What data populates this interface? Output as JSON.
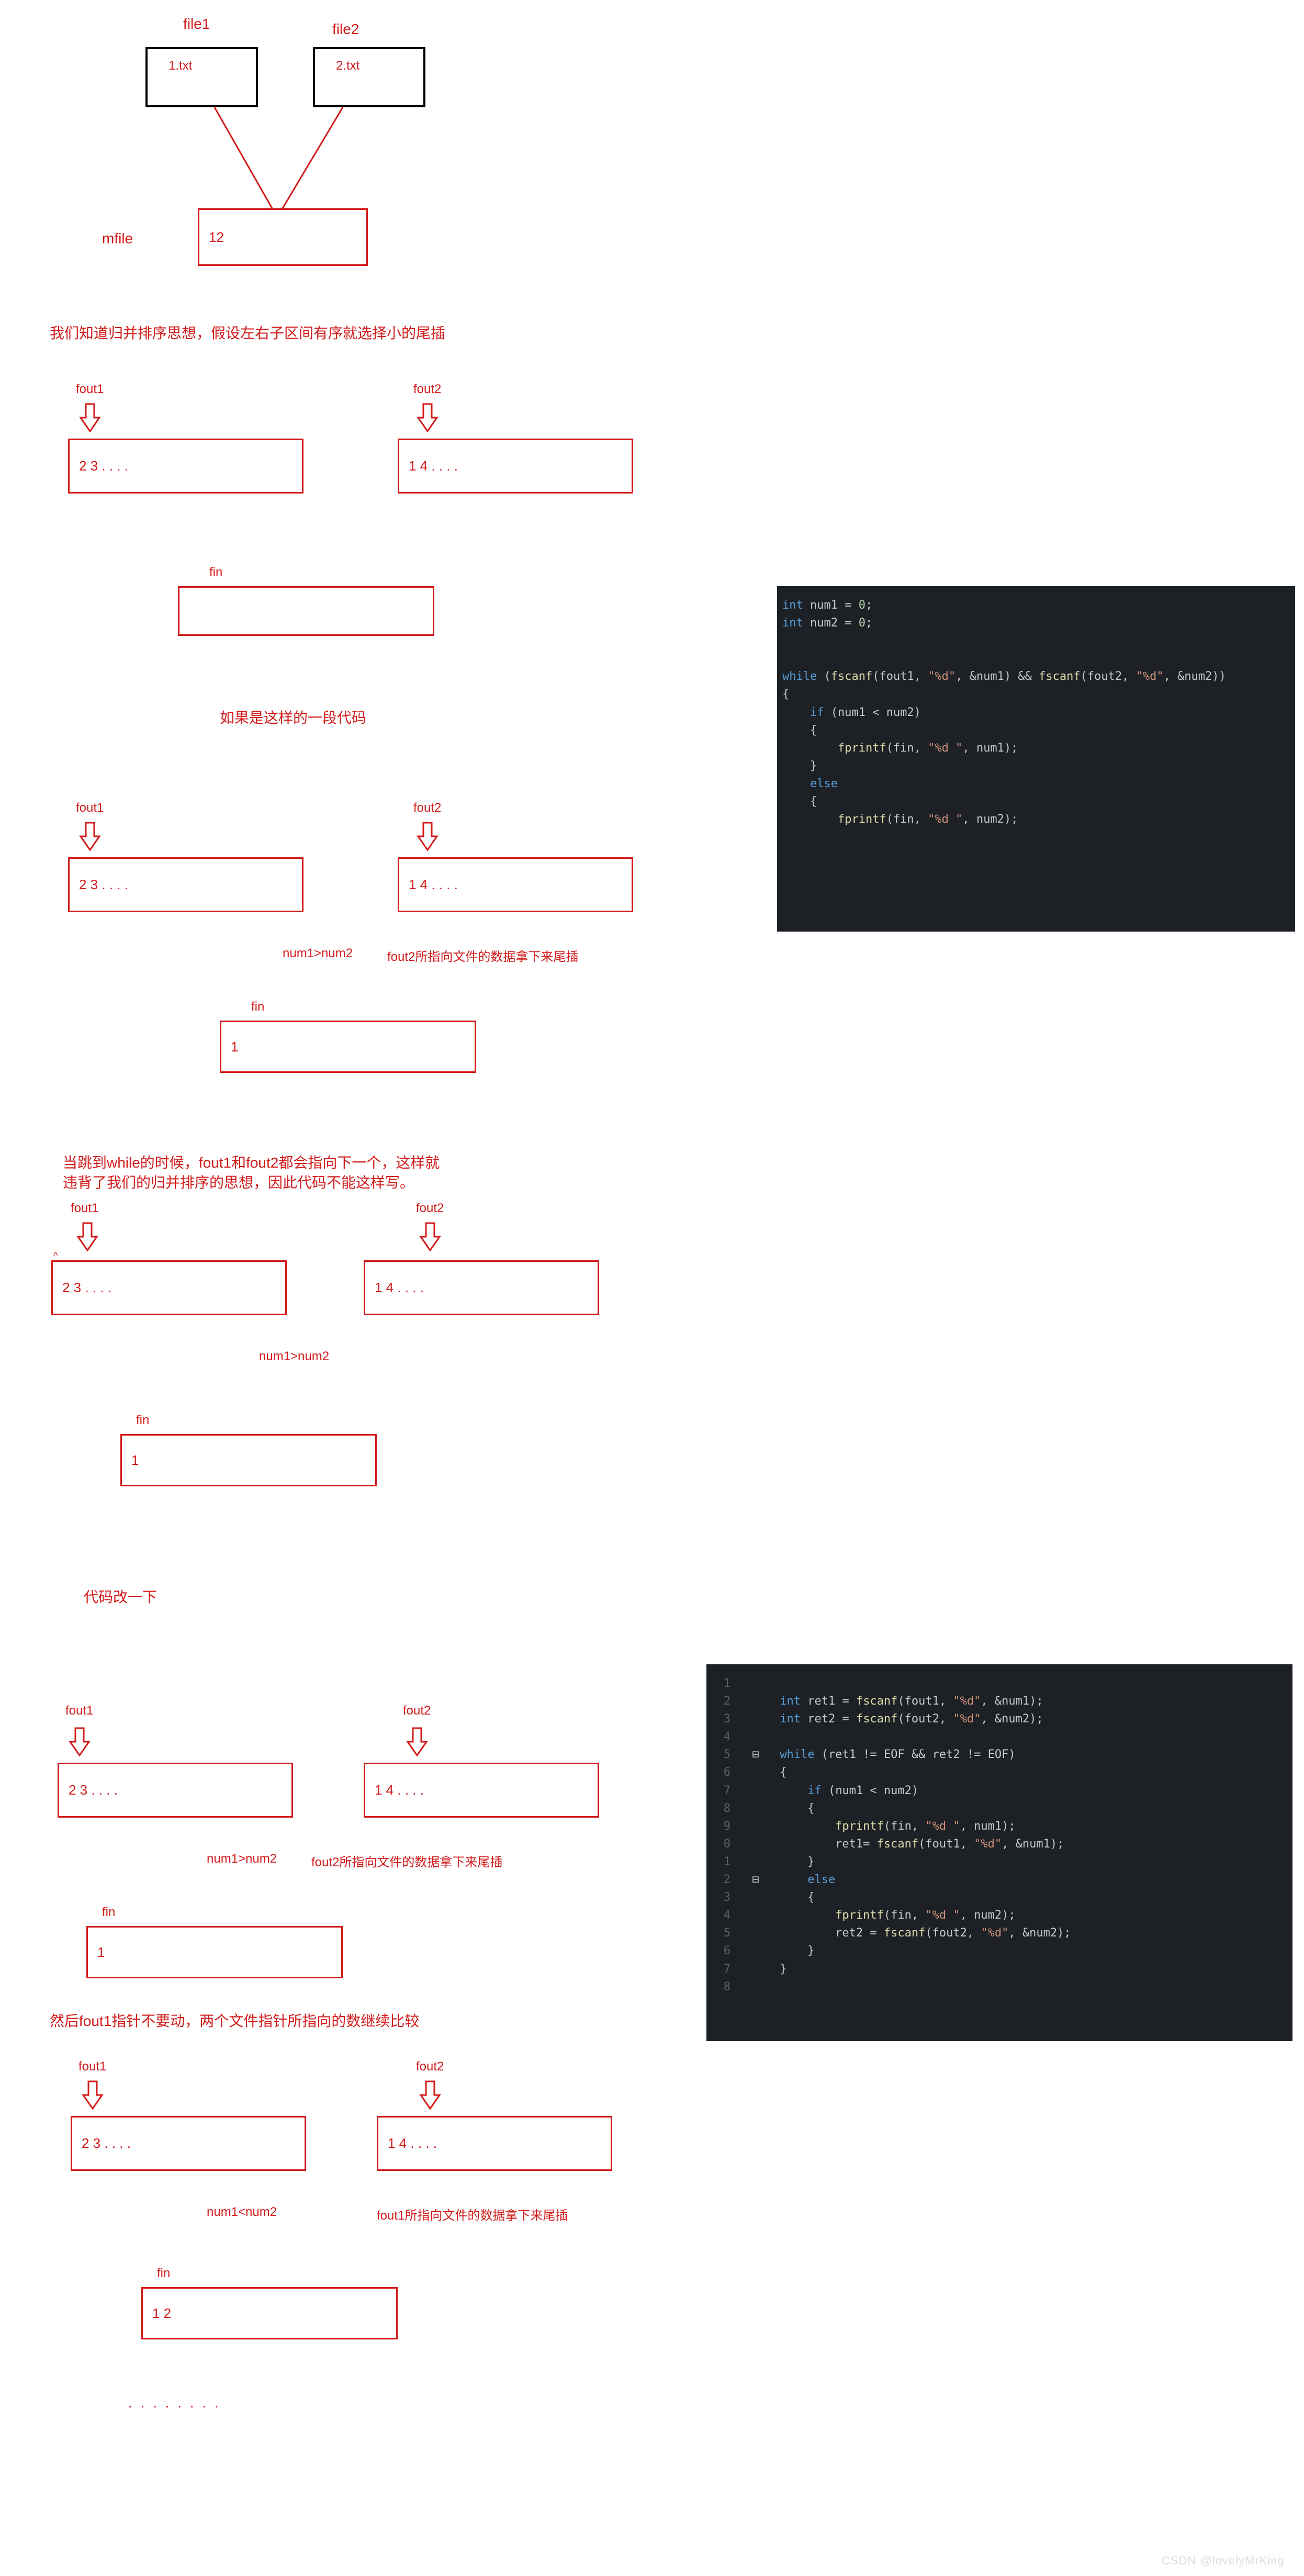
{
  "top": {
    "file1_label": "file1",
    "file2_label": "file2",
    "file1_box": "1.txt",
    "file2_box": "2.txt",
    "mfile_label": "mfile",
    "merge_box": "12"
  },
  "text1": "我们知道归并排序思想，假设左右子区间有序就选择小的尾插",
  "step1": {
    "fout1_label": "fout1",
    "fout2_label": "fout2",
    "fout1_box": "2  3 . . . .",
    "fout2_box": "1 4 . . . .",
    "fin_label": "fin",
    "fin_box": ""
  },
  "text2": "如果是这样的一段代码",
  "step2": {
    "fout1_label": "fout1",
    "fout2_label": "fout2",
    "fout1_box": "2  3 . . . .",
    "fout2_box": "1 4 . . . .",
    "comp": "num1>num2",
    "note": "fout2所指向文件的数据拿下来尾插",
    "fin_label": "fin",
    "fin_box": "1"
  },
  "text3a": "当跳到while的时候，fout1和fout2都会指向下一个，这样就",
  "text3b": "违背了我们的归并排序的思想，因此代码不能这样写。",
  "step3": {
    "fout1_label": "fout1",
    "fout2_label": "fout2",
    "fout1_box": "2  3 . . . .",
    "fout2_box": "1 4 . . . .",
    "comp": "num1>num2",
    "fin_label": "fin",
    "fin_box": "1"
  },
  "text4": "代码改一下",
  "step4": {
    "fout1_label": "fout1",
    "fout2_label": "fout2",
    "fout1_box": "2  3 . . . .",
    "fout2_box": "1 4 . . . .",
    "comp": "num1>num2",
    "note": "fout2所指向文件的数据拿下来尾插",
    "fin_label": "fin",
    "fin_box": "1"
  },
  "text5": "然后fout1指针不要动，两个文件指针所指向的数继续比较",
  "step5": {
    "fout1_label": "fout1",
    "fout2_label": "fout2",
    "fout1_box": "2  3 . . . .",
    "fout2_box": "1 4 . . . .",
    "comp": "num1<num2",
    "note": "fout1所指向文件的数据拿下来尾插",
    "fin_label": "fin",
    "fin_box": "1 2"
  },
  "dots": ". . . . . . . .",
  "code1": {
    "l1": "int num1 = 0;",
    "l2": "int num2 = 0;",
    "l3": "while (fscanf(fout1, \"%d\", &num1) && fscanf(fout2, \"%d\", &num2))",
    "l4": "{",
    "l5": "    if (num1 < num2)",
    "l6": "    {",
    "l7": "        fprintf(fin, \"%d \", num1);",
    "l8": "    }",
    "l9": "    else",
    "l10": "    {",
    "l11": "        fprintf(fin, \"%d \", num2);",
    "l12": "        "
  },
  "code2": {
    "l1": "int ret1 = fscanf(fout1, \"%d\", &num1);",
    "l2": "int ret2 = fscanf(fout2, \"%d\", &num2);",
    "l3": "",
    "l4": "while (ret1 != EOF && ret2 != EOF)",
    "l5": "{",
    "l6": "    if (num1 < num2)",
    "l7": "    {",
    "l8": "        fprintf(fin, \"%d \", num1);",
    "l9": "        ret1= fscanf(fout1, \"%d\", &num1);",
    "l10": "    }",
    "l11": "    else",
    "l12": "    {",
    "l13": "        fprintf(fin, \"%d \", num2);",
    "l14": "        ret2 = fscanf(fout2, \"%d\", &num2);",
    "l15": "    }",
    "l16": "}"
  },
  "watermark": "CSDN @lovelyMrKing"
}
